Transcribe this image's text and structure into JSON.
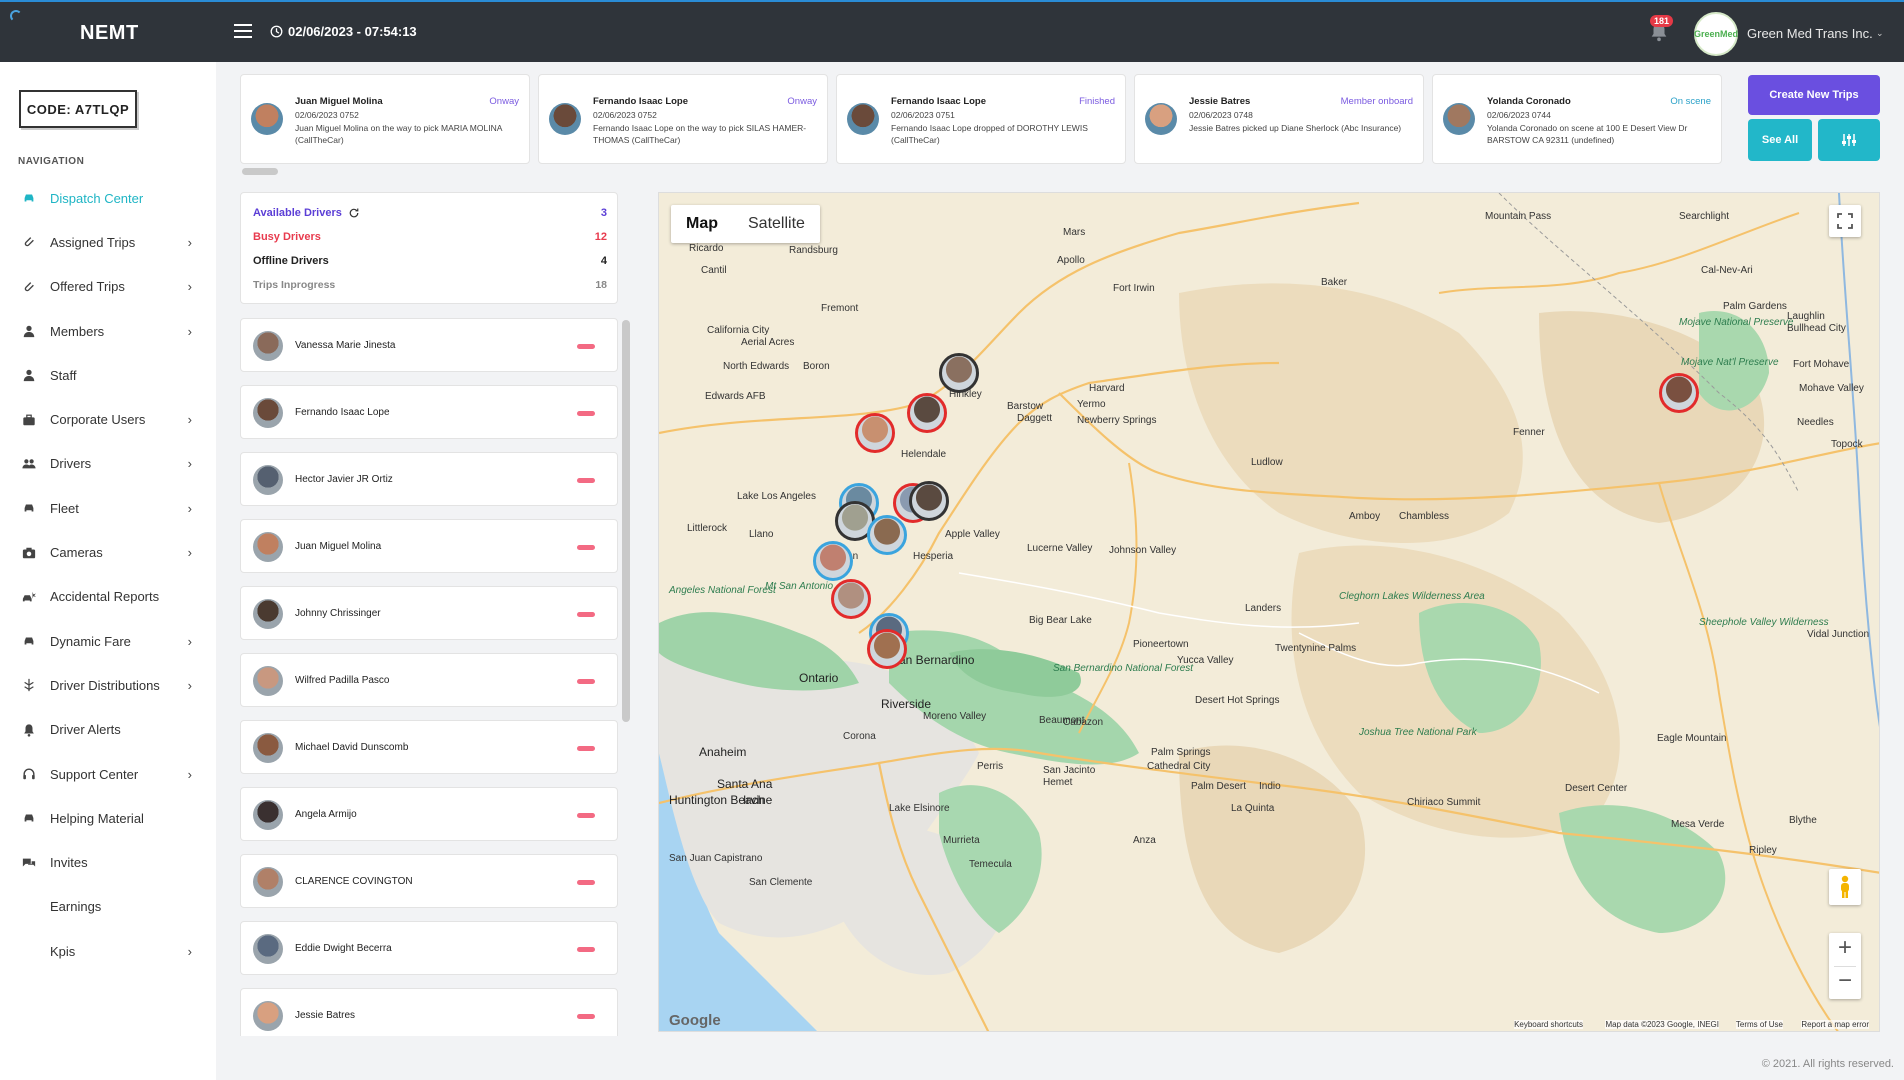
{
  "header": {
    "brand": "NEMT",
    "datetime": "02/06/2023 - 07:54:13",
    "notifications_count": "181",
    "company_logo_text": "GreenMed",
    "company_name": "Green Med Trans Inc."
  },
  "sidebar": {
    "code_label": "CODE: A7TLQP",
    "nav_heading": "NAVIGATION",
    "items": [
      {
        "label": "Dispatch Center",
        "icon": "car-icon",
        "chevron": false,
        "active": true
      },
      {
        "label": "Assigned Trips",
        "icon": "paperclip-icon",
        "chevron": true
      },
      {
        "label": "Offered Trips",
        "icon": "paperclip-icon",
        "chevron": true
      },
      {
        "label": "Members",
        "icon": "user-icon",
        "chevron": true
      },
      {
        "label": "Staff",
        "icon": "user-icon",
        "chevron": false
      },
      {
        "label": "Corporate Users",
        "icon": "briefcase-icon",
        "chevron": true
      },
      {
        "label": "Drivers",
        "icon": "users-icon",
        "chevron": true
      },
      {
        "label": "Fleet",
        "icon": "car-icon",
        "chevron": true
      },
      {
        "label": "Cameras",
        "icon": "camera-icon",
        "chevron": true
      },
      {
        "label": "Accidental Reports",
        "icon": "car-crash-icon",
        "chevron": false
      },
      {
        "label": "Dynamic Fare",
        "icon": "car-icon",
        "chevron": true
      },
      {
        "label": "Driver Distributions",
        "icon": "distribution-icon",
        "chevron": true
      },
      {
        "label": "Driver Alerts",
        "icon": "bell-icon",
        "chevron": false
      },
      {
        "label": "Support Center",
        "icon": "headset-icon",
        "chevron": true
      },
      {
        "label": "Helping Material",
        "icon": "car-icon",
        "chevron": false
      },
      {
        "label": "Invites",
        "icon": "comments-icon",
        "chevron": false
      },
      {
        "label": "Earnings",
        "icon": "",
        "chevron": false
      },
      {
        "label": "Kpis",
        "icon": "",
        "chevron": true
      }
    ]
  },
  "trip_cards": [
    {
      "name": "Juan Miguel Molina",
      "status": "Onway",
      "status_color": "#7a5ae0",
      "date": "02/06/2023 0752",
      "desc": "Juan Miguel Molina on the way to pick MARIA MOLINA (CallTheCar)",
      "avatar_color": "#c08060"
    },
    {
      "name": "Fernando Isaac Lope",
      "status": "Onway",
      "status_color": "#7a5ae0",
      "date": "02/06/2023 0752",
      "desc": "Fernando Isaac Lope on the way to pick SILAS HAMER-THOMAS (CallTheCar)",
      "avatar_color": "#6a4a3a"
    },
    {
      "name": "Fernando Isaac Lope",
      "status": "Finished",
      "status_color": "#7a5ae0",
      "date": "02/06/2023 0751",
      "desc": "Fernando Isaac Lope dropped of DOROTHY LEWIS (CallTheCar)",
      "avatar_color": "#6a4a3a"
    },
    {
      "name": "Jessie Batres",
      "status": "Member onboard",
      "status_color": "#7a5ae0",
      "date": "02/06/2023 0748",
      "desc": "Jessie Batres picked up Diane Sherlock (Abc Insurance)",
      "avatar_color": "#d8a080"
    },
    {
      "name": "Yolanda Coronado",
      "status": "On scene",
      "status_color": "#2aa1c8",
      "date": "02/06/2023 0744",
      "desc": "Yolanda Coronado on scene at 100 E Desert View Dr BARSTOW CA 92311 (undefined)",
      "avatar_color": "#a07860"
    }
  ],
  "actions": {
    "create_new_trips": "Create New Trips",
    "see_all": "See All"
  },
  "stats": {
    "available": {
      "label": "Available Drivers",
      "value": "3",
      "color": "#5b3ed6"
    },
    "busy": {
      "label": "Busy Drivers",
      "value": "12",
      "color": "#e83b4e"
    },
    "offline": {
      "label": "Offline Drivers",
      "value": "4",
      "color": "#222222"
    },
    "inprogress": {
      "label": "Trips Inprogress",
      "value": "18",
      "color": "#888888"
    }
  },
  "drivers": [
    {
      "name": "Vanessa Marie Jinesta",
      "avatar_color": "#8a6a5a"
    },
    {
      "name": "Fernando Isaac Lope",
      "avatar_color": "#6a4a3a"
    },
    {
      "name": "Hector Javier JR Ortiz",
      "avatar_color": "#556070"
    },
    {
      "name": "Juan Miguel Molina",
      "avatar_color": "#c08060"
    },
    {
      "name": "Johnny Chrissinger",
      "avatar_color": "#4a3a30"
    },
    {
      "name": "Wilfred Padilla Pasco",
      "avatar_color": "#c89880"
    },
    {
      "name": "Michael David Dunscomb",
      "avatar_color": "#8a5a40"
    },
    {
      "name": "Angela Armijo",
      "avatar_color": "#3a3030"
    },
    {
      "name": "CLARENCE COVINGTON",
      "avatar_color": "#b08068"
    },
    {
      "name": "Eddie Dwight Becerra",
      "avatar_color": "#5a6a80"
    },
    {
      "name": "Jessie Batres",
      "avatar_color": "#d8a080"
    }
  ],
  "map": {
    "type_map": "Map",
    "type_satellite": "Satellite",
    "google_logo": "Google",
    "footer": {
      "shortcuts": "Keyboard shortcuts",
      "data": "Map data ©2023 Google, INEGI",
      "terms": "Terms of Use",
      "report": "Report a map error"
    },
    "labels": [
      "Mars",
      "Apollo",
      "Fort Irwin",
      "Mountain Pass",
      "Searchlight",
      "Ricardo",
      "Randsburg",
      "Cantil",
      "Baker",
      "Cal-Nev-Ari",
      "Palm Gardens",
      "Laughlin",
      "Bullhead City",
      "Fremont",
      "California City",
      "Aerial Acres",
      "Mojave National Preserve",
      "Mojave Nat'l Preserve",
      "North Edwards",
      "Boron",
      "Fort Mohave",
      "Edwards AFB",
      "Hinkley",
      "Harvard",
      "Mohave Valley",
      "Barstow",
      "Yermo",
      "Daggett",
      "Newberry Springs",
      "Needles",
      "Fenner",
      "Topock",
      "Helendale",
      "Ludlow",
      "Lake Los Angeles",
      "Amboy",
      "Chambless",
      "Littlerock",
      "Llano",
      "Apple Valley",
      "Lucerne Valley",
      "Johnson Valley",
      "Phelan",
      "Hesperia",
      "Angeles National Forest",
      "Mt San Antonio",
      "Landers",
      "Cleghorn Lakes Wilderness Area",
      "Sheephole Valley Wilderness",
      "Big Bear Lake",
      "Vidal Junction",
      "Pioneertown",
      "Twentynine Palms",
      "Yucca Valley",
      "San Bernardino",
      "Ontario",
      "San Bernardino National Forest",
      "Riverside",
      "Desert Hot Springs",
      "Moreno Valley",
      "Beaumont",
      "Cabazon",
      "Joshua Tree National Park",
      "Anaheim",
      "Corona",
      "Eagle Mountain",
      "Palm Springs",
      "Cathedral City",
      "Perris",
      "San Jacinto",
      "Hemet",
      "Santa Ana",
      "Palm Desert",
      "Indio",
      "Desert Center",
      "Huntington Beach",
      "Irvine",
      "La Quinta",
      "Chiriaco Summit",
      "Lake Elsinore",
      "Murrieta",
      "Anza",
      "Mesa Verde",
      "Blythe",
      "Temecula",
      "Ripley",
      "San Juan Capistrano",
      "San Clemente"
    ]
  },
  "footer": {
    "copyright": "© 2021. All rights reserved."
  }
}
